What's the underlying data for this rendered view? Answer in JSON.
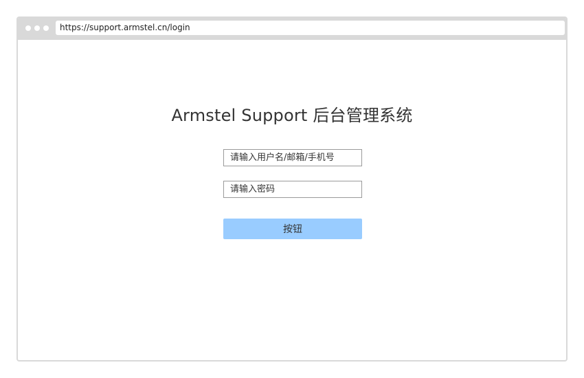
{
  "browser": {
    "url": "https://support.armstel.cn/login"
  },
  "login": {
    "title": "Armstel Support 后台管理系统",
    "username_placeholder": "请输入用户名/邮箱/手机号",
    "password_placeholder": "请输入密码",
    "submit_label": "按钮"
  },
  "colors": {
    "browser_chrome": "#d9d9d9",
    "button_background": "#99ccff",
    "text": "#333333"
  }
}
